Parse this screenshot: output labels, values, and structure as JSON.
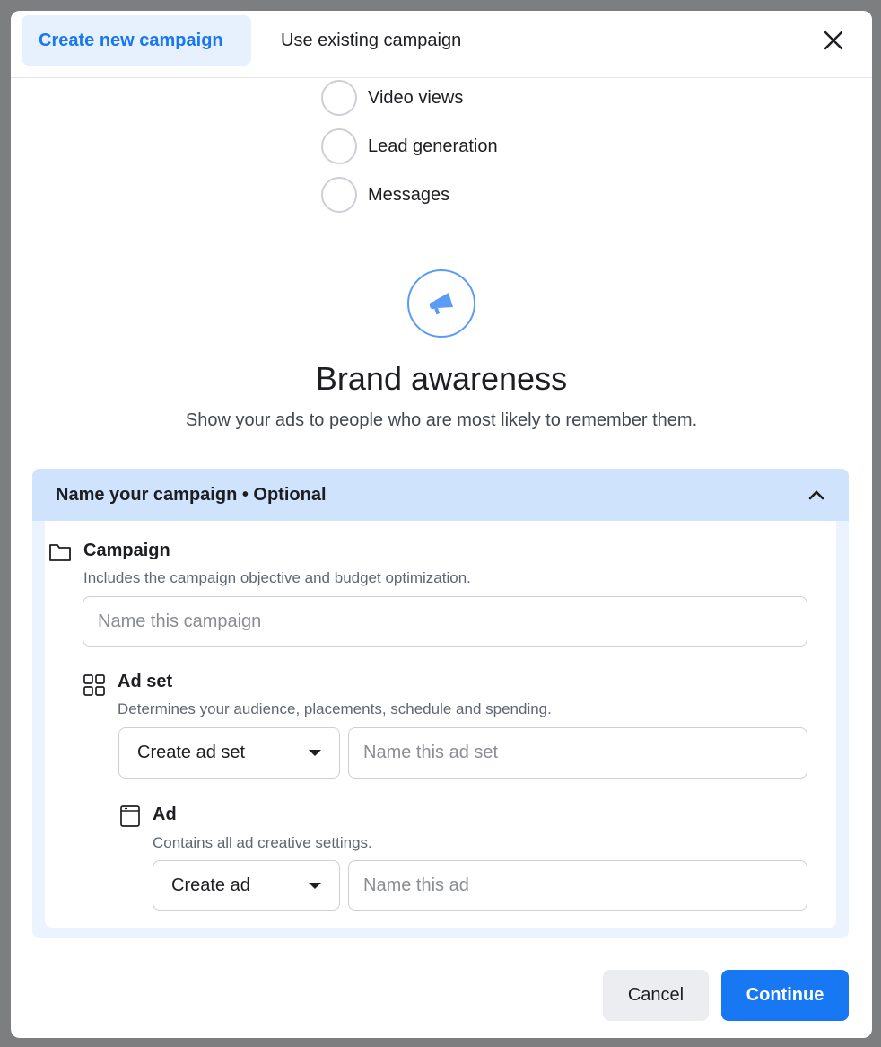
{
  "header": {
    "tabs": [
      {
        "label": "Create new campaign",
        "active": true
      },
      {
        "label": "Use existing campaign",
        "active": false
      }
    ],
    "close_icon": "close-icon"
  },
  "objectives": [
    {
      "label": "Video views"
    },
    {
      "label": "Lead generation"
    },
    {
      "label": "Messages"
    }
  ],
  "selected": {
    "icon": "megaphone-icon",
    "title": "Brand awareness",
    "description": "Show your ads to people who are most likely to remember them."
  },
  "naming": {
    "header": "Name your campaign • Optional",
    "campaign": {
      "title": "Campaign",
      "description": "Includes the campaign objective and budget optimization.",
      "placeholder": "Name this campaign"
    },
    "adset": {
      "title": "Ad set",
      "description": "Determines your audience, placements, schedule and spending.",
      "select": "Create ad set",
      "placeholder": "Name this ad set"
    },
    "ad": {
      "title": "Ad",
      "description": "Contains all ad creative settings.",
      "select": "Create ad",
      "placeholder": "Name this ad"
    }
  },
  "footer": {
    "cancel": "Cancel",
    "continue": "Continue"
  },
  "colors": {
    "accent": "#1877f2",
    "tab_active_bg": "#e7f0fd",
    "section_header_bg": "#cfe3fc"
  }
}
